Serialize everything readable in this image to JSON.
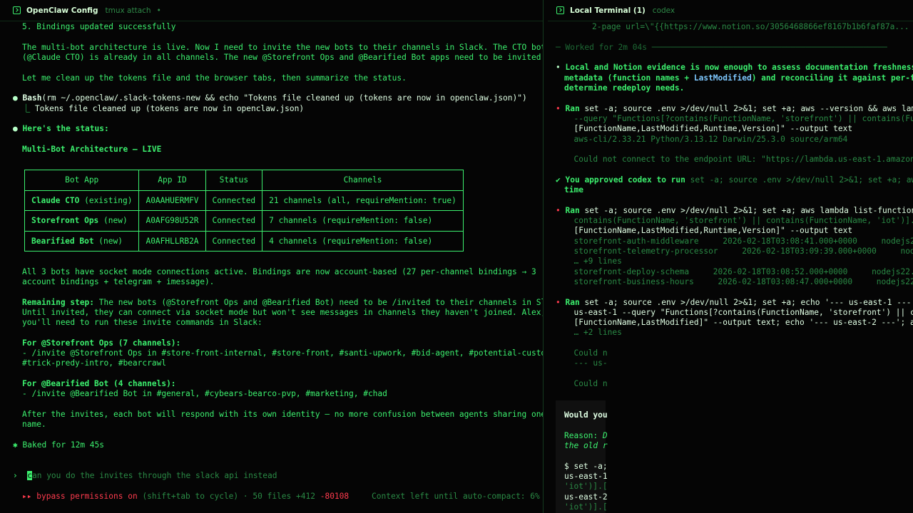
{
  "left": {
    "title": "OpenClaw Config",
    "subtitle": "tmux attach",
    "dot": "•",
    "lines": {
      "l1": "5. Bindings updated successfully",
      "l2": "The multi-bot architecture is live. Now I need to invite the new bots to their channels in Slack. The CTO bot",
      "l3": "(@Claude CTO) is already in all channels. The new @Storefront Ops and @Bearified Bot apps need to be invited.",
      "l4": "Let me clean up the tokens file and the browser tabs, then summarize the status.",
      "bash_label": "Bash",
      "bash_cmd": "(rm ~/.openclaw/.slack-tokens-new && echo \"Tokens file cleaned up (tokens are now in openclaw.json)\")",
      "bash_out": "Tokens file cleaned up (tokens are now in openclaw.json)",
      "status": "Here's the status:",
      "arch": "Multi-Bot Architecture — LIVE",
      "after1": "All 3 bots have socket mode connections active. Bindings are now account-based (27 per-channel bindings → 3",
      "after2": "account bindings + telegram + imessage).",
      "rem_label": "Remaining step:",
      "rem1": " The new bots (@Storefront Ops and @Bearified Bot) need to be /invited to their channels in Slack.",
      "rem2": "Until invited, they can connect via socket mode but won't see messages in channels they haven't joined. Alex,",
      "rem3": "you'll need to run these invite commands in Slack:",
      "so_head": "For @Storefront Ops (7 channels):",
      "so_cmd1": "- /invite @Storefront Ops in #store-front-internal, #store-front, #santi-upwork, #bid-agent, #potential-customer,",
      "so_cmd2": "#trick-predy-intro, #bearcrawl",
      "bb_head": "For @Bearified Bot (4 channels):",
      "bb_cmd": "- /invite @Bearified Bot in #general, #cybears-bearco-pvp, #marketing, #chad",
      "fin1": "After the invites, each bot will respond with its own identity — no more confusion between agents sharing one bot",
      "fin2": "name.",
      "baked": "Baked for 12m 45s"
    },
    "table": {
      "headers": [
        "Bot App",
        "App ID",
        "Status",
        "Channels"
      ],
      "rows": [
        {
          "name": "Claude CTO",
          "suffix": " (existing)",
          "id": "A0AAHUERMFV",
          "status": "Connected",
          "channels": "21 channels (all, requireMention: true)"
        },
        {
          "name": "Storefront Ops",
          "suffix": " (new)",
          "id": "A0AFG98U52R",
          "status": "Connected",
          "channels": "7 channels (requireMention: false)"
        },
        {
          "name": "Bearified Bot",
          "suffix": " (new)",
          "id": "A0AFHLLRB2A",
          "status": "Connected",
          "channels": "4 channels (requireMention: false)"
        }
      ]
    },
    "input": {
      "prompt": "›",
      "first_char": "c",
      "text": "an you do the invites through the slack api instead"
    },
    "footer": {
      "arrows": "▸▸",
      "mode": "bypass permissions on",
      "hint": "(shift+tab to cycle)",
      "files": "· 50 files",
      "added": "+412",
      "removed": "-80108",
      "context": "Context left until auto-compact: 6%"
    }
  },
  "right": {
    "title": "Local Terminal (1)",
    "subtitle": "codex",
    "lines": {
      "r0": "2-page url=\\\"{{https://www.notion.so/3056468866ef8167b1b6faf87a...",
      "worked": "─ Worked for 2m 04s ─────────────────────────────────────────────────",
      "r1": "Local and Notion evidence is now enough to assess documentation freshness; ne",
      "r2a": "metadata (function names + ",
      "r2b": "LastModified",
      "r2c": ") and reconciling it against per-funct",
      "r3": "determine redeploy needs.",
      "ran": "Ran",
      "c1": " set -a; source .env >/dev/null 2>&1; set +a; aws --version && aws lambda ",
      "c1b": "  --query \"Functions[?contains(FunctionName, 'storefront') || contains(Functi",
      "c1c": "  [FunctionName,LastModified,Runtime,Version]\" --output text",
      "c1d": "  aws-cli/2.33.21 Python/3.13.12 Darwin/25.3.0 source/arm64",
      "c1e": "  Could not connect to the endpoint URL: \"https://lambda.us-east-1.amazonaws.",
      "appr_a": "You approved codex to run",
      "appr_b": " set -a; source .env >/dev/null 2>&1; set +a; aws la",
      "appr_c": "time",
      "c2": " set -a; source .env >/dev/null 2>&1; set +a; aws lambda list-functions --",
      "c2b": "  contains(FunctionName, 'storefront') || contains(FunctionName, 'iot')].",
      "c2c": "  [FunctionName,LastModified,Runtime,Version]\" --output text",
      "f1": "  storefront-auth-middleware     2026-02-18T03:08:41.000+0000     nodejs22.x",
      "f2": "  storefront-telemetry-processor     2026-02-18T03:09:39.000+0000     nodejs22.",
      "more9": "  … +9 lines",
      "f3": "  storefront-deploy-schema     2026-02-18T03:08:52.000+0000     nodejs22.x     S",
      "f4": "  storefront-business-hours     2026-02-18T03:08:47.000+0000     nodejs22.x",
      "c3": " set -a; source .env >/dev/null 2>&1; set +a; echo '--- us-east-1 ---'; aw",
      "c3b": "  us-east-1 --query \"Functions[?contains(FunctionName, 'storefront') || conta",
      "c3c": "  [FunctionName,LastModified]\" --output text; echo '--- us-east-2 ---'; aws l",
      "more2": "  … +2 lines",
      "cn1": "  Could n",
      "cn2": "  --- us-",
      "cn3": "  Could n",
      "would": "Would you",
      "reason_a": "Reason: ",
      "reason_b": "D",
      "reason2": "the old r",
      "d1": "$ set -a;",
      "d2": "us-east-1",
      "d3": "'iot')].[",
      "d4": "us-east-2",
      "d5": "'iot')].["
    }
  }
}
